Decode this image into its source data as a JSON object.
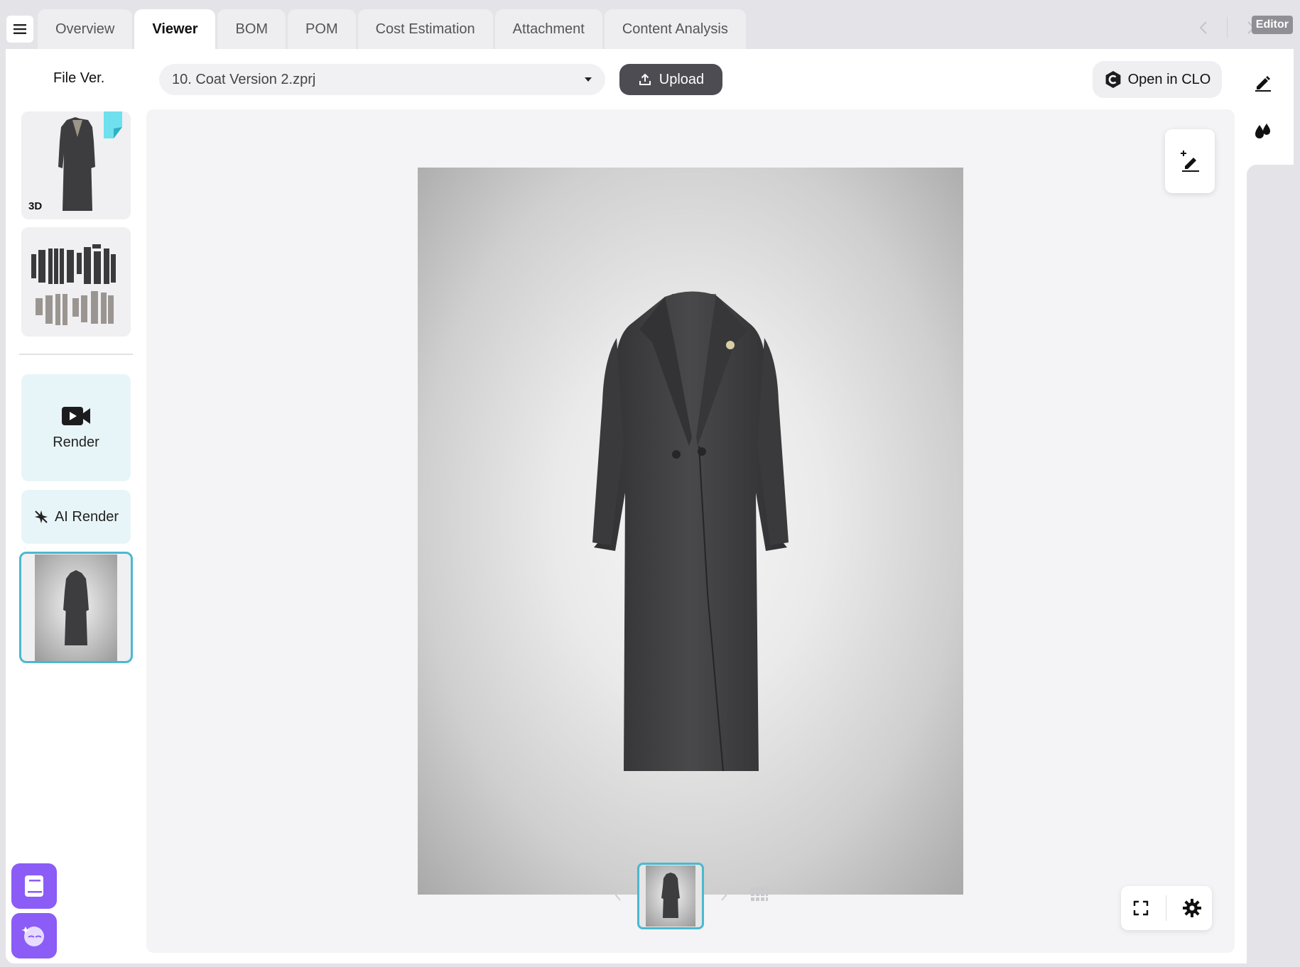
{
  "tabs": [
    "Overview",
    "Viewer",
    "BOM",
    "POM",
    "Cost Estimation",
    "Attachment",
    "Content Analysis"
  ],
  "active_tab": "Viewer",
  "editor_badge": "Editor",
  "toolbar": {
    "file_ver_label": "File Ver.",
    "file_select_value": "10. Coat Version 2.zprj",
    "upload_label": "Upload",
    "open_clo_label": "Open in CLO"
  },
  "sidebar": {
    "thumb_3d_badge": "3D",
    "render_label": "Render",
    "ai_render_label": "AI Render"
  },
  "colors": {
    "accent_teal": "#4bb8cf",
    "flag_cyan": "#6fe0ee",
    "purple": "#8b5cf6",
    "coat": "#3d3d3f"
  },
  "icons": {
    "menu": "menu-icon",
    "prev": "chevron-left-icon",
    "next": "chevron-right-icon",
    "dropdown": "caret-down-icon",
    "upload": "upload-icon",
    "clo": "clo-logo-icon",
    "pen": "pen-icon",
    "drops": "drops-icon",
    "render": "video-camera-icon",
    "ai_render": "ai-sparkle-icon",
    "annotate": "add-annotation-icon",
    "fullscreen": "fullscreen-icon",
    "settings": "gear-icon",
    "grid": "grid-icon",
    "book": "book-icon",
    "assistant": "assistant-icon"
  }
}
